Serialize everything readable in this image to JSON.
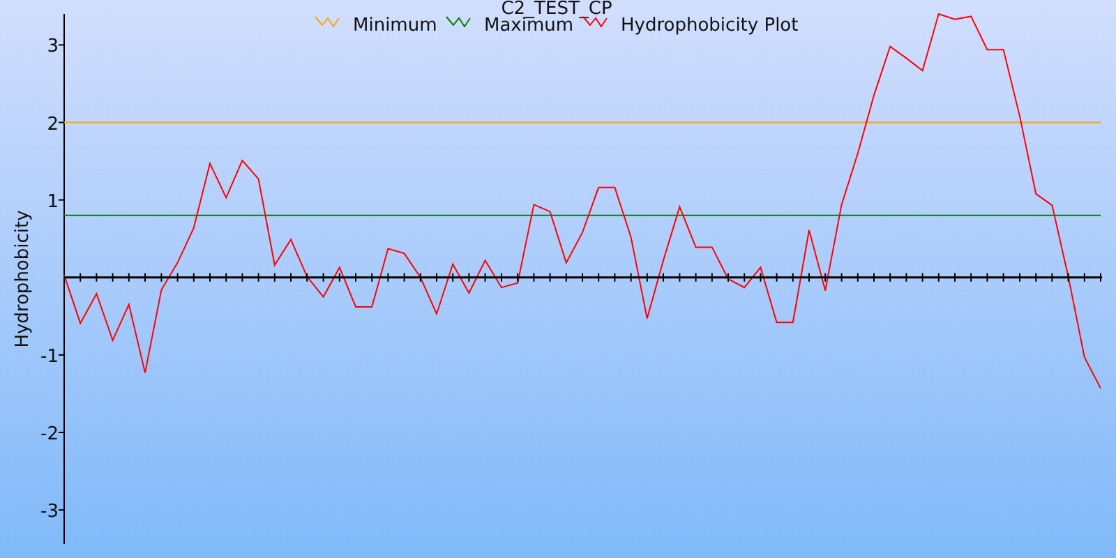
{
  "chart": {
    "chart_data": {
      "type": "line",
      "title": "C2_TEST_CP",
      "ylabel": "Hydrophobicity",
      "ylim": [
        -3.44,
        3.4
      ],
      "yticks": [
        -3,
        -2,
        -1,
        1,
        2,
        3
      ],
      "legend": true,
      "series": [
        {
          "name": "Minimum",
          "color": "#ffa500",
          "values": [
            2,
            2,
            2,
            2,
            2,
            2,
            2,
            2,
            2,
            2,
            2,
            2,
            2,
            2,
            2,
            2,
            2,
            2,
            2,
            2,
            2,
            2,
            2,
            2,
            2,
            2,
            2,
            2,
            2,
            2,
            2,
            2,
            2,
            2,
            2,
            2,
            2,
            2,
            2,
            2,
            2,
            2,
            2,
            2,
            2,
            2,
            2,
            2,
            2,
            2,
            2,
            2,
            2,
            2,
            2,
            2,
            2,
            2,
            2,
            2,
            2,
            2,
            2,
            2,
            2
          ]
        },
        {
          "name": "Maximum",
          "color": "#008000",
          "values": [
            0.8,
            0.8,
            0.8,
            0.8,
            0.8,
            0.8,
            0.8,
            0.8,
            0.8,
            0.8,
            0.8,
            0.8,
            0.8,
            0.8,
            0.8,
            0.8,
            0.8,
            0.8,
            0.8,
            0.8,
            0.8,
            0.8,
            0.8,
            0.8,
            0.8,
            0.8,
            0.8,
            0.8,
            0.8,
            0.8,
            0.8,
            0.8,
            0.8,
            0.8,
            0.8,
            0.8,
            0.8,
            0.8,
            0.8,
            0.8,
            0.8,
            0.8,
            0.8,
            0.8,
            0.8,
            0.8,
            0.8,
            0.8,
            0.8,
            0.8,
            0.8,
            0.8,
            0.8,
            0.8,
            0.8,
            0.8,
            0.8,
            0.8,
            0.8,
            0.8,
            0.8,
            0.8,
            0.8,
            0.8,
            0.8
          ]
        },
        {
          "name": "Hydrophobicity Plot",
          "color": "#ff0000",
          "values": [
            0.03,
            -0.59,
            -0.21,
            -0.81,
            -0.35,
            -1.23,
            -0.16,
            0.19,
            0.64,
            1.47,
            1.03,
            1.51,
            1.27,
            0.16,
            0.49,
            0.01,
            -0.25,
            0.13,
            -0.38,
            -0.38,
            0.37,
            0.31,
            0.0,
            -0.47,
            0.17,
            -0.2,
            0.22,
            -0.13,
            -0.07,
            0.94,
            0.85,
            0.19,
            0.58,
            1.16,
            1.16,
            0.52,
            -0.53,
            0.22,
            0.91,
            0.39,
            0.39,
            -0.02,
            -0.13,
            0.13,
            -0.58,
            -0.58,
            0.61,
            -0.17,
            0.94,
            1.6,
            2.35,
            2.98,
            2.83,
            2.67,
            3.4,
            3.33,
            3.37,
            2.94,
            2.94,
            2.08,
            1.08,
            0.93,
            0.01,
            -1.03,
            -1.43
          ]
        }
      ]
    }
  }
}
